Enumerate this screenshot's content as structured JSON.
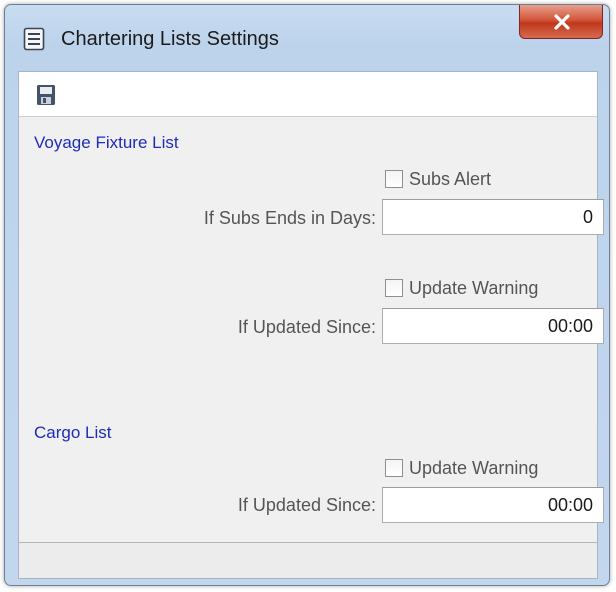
{
  "window": {
    "title": "Chartering Lists Settings"
  },
  "icons": {
    "app": "list-window-icon",
    "close": "close-icon",
    "save": "save-disk-icon"
  },
  "colors": {
    "section_title": "#1d2db8",
    "close_button": "#c8462c",
    "frame": "#bdd3ec"
  },
  "voyage_fixture": {
    "section_title": "Voyage Fixture List",
    "subs_alert": {
      "label": "Subs Alert",
      "checked": false
    },
    "subs_days": {
      "label": "If Subs Ends in Days:",
      "value": "0"
    },
    "update_warning": {
      "label": "Update Warning",
      "checked": false
    },
    "updated_since": {
      "label": "If Updated Since:",
      "value": "00:00"
    }
  },
  "cargo": {
    "section_title": "Cargo List",
    "update_warning": {
      "label": "Update Warning",
      "checked": false
    },
    "updated_since": {
      "label": "If Updated Since:",
      "value": "00:00"
    }
  }
}
